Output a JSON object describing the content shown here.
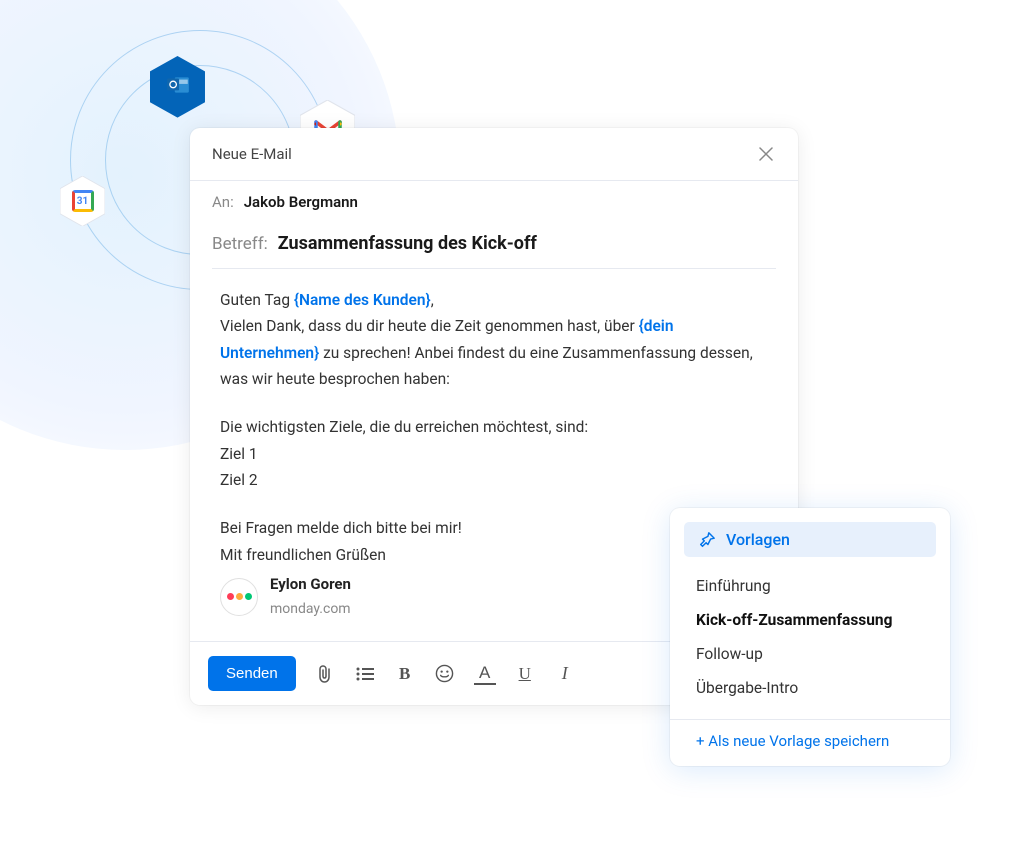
{
  "composer": {
    "title": "Neue E-Mail",
    "to_label": "An:",
    "to_value": "Jakob Bergmann",
    "subject_label": "Betreff:",
    "subject_value": "Zusammenfassung des Kick-off"
  },
  "body": {
    "greeting_pre": "Guten Tag ",
    "greeting_placeholder": "{Name des Kunden}",
    "greeting_post": ",",
    "line2_pre": "Vielen Dank, dass du dir heute die Zeit genommen hast, über ",
    "line2_placeholder": "{dein Unternehmen}",
    "line2_post": " zu sprechen! Anbei findest du eine Zusammenfassung dessen, was wir heute besprochen haben:",
    "goals_intro": "Die wichtigsten Ziele, die du erreichen möchtest, sind:",
    "goal1": "Ziel 1",
    "goal2": "Ziel 2",
    "closing1": "Bei Fragen melde dich bitte bei mir!",
    "closing2": "Mit freundlichen Grüßen"
  },
  "signature": {
    "name": "Eylon Goren",
    "company": "monday.com"
  },
  "toolbar": {
    "send_label": "Senden"
  },
  "templates": {
    "header": "Vorlagen",
    "items": [
      "Einführung",
      "Kick-off-Zusammenfassung",
      "Follow-up",
      "Übergabe-Intro"
    ],
    "save_as_new": "+ Als neue Vorlage speichern",
    "active_index": 1
  },
  "integrations": {
    "outlook": "Outlook",
    "gmail": "Gmail",
    "gcal": "Google Calendar",
    "gcal_day": "31"
  }
}
